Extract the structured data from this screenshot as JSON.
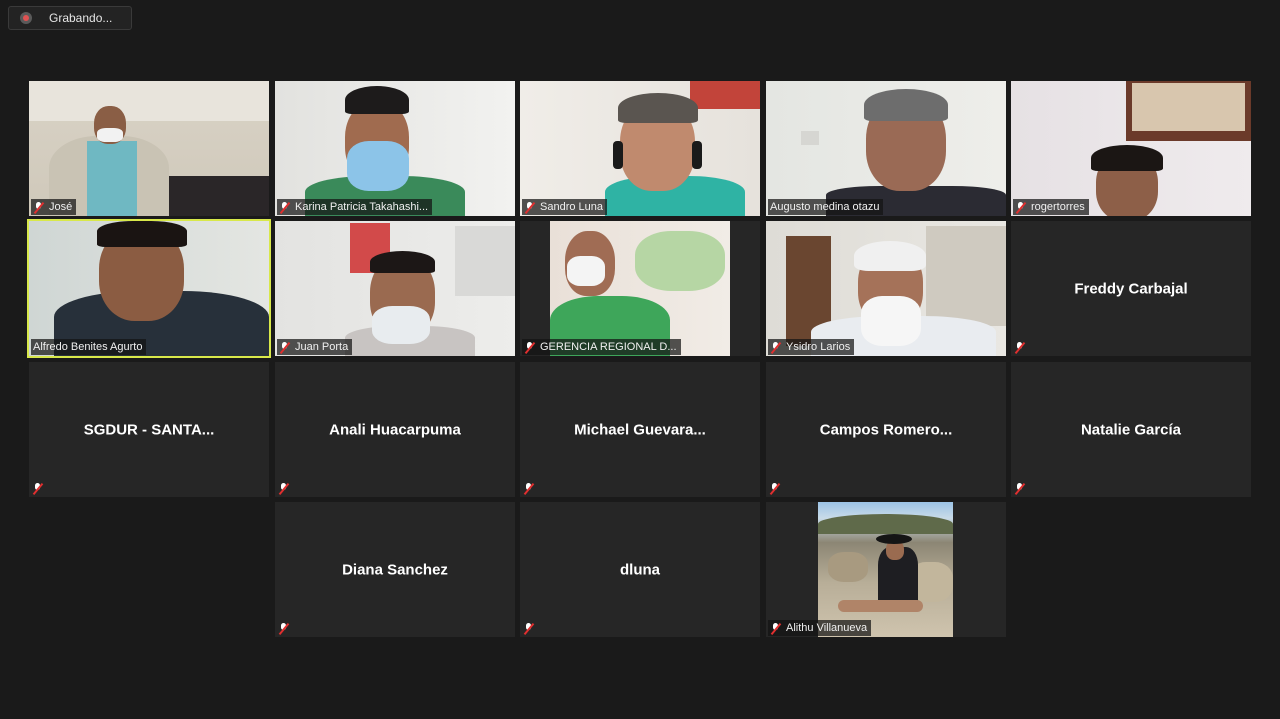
{
  "recording": {
    "label": "Grabando..."
  },
  "participants": [
    {
      "name": "José",
      "muted": true,
      "video": true
    },
    {
      "name": "Karina Patricia Takahashi...",
      "muted": true,
      "video": true
    },
    {
      "name": "Sandro Luna",
      "muted": true,
      "video": true
    },
    {
      "name": "Augusto medina otazu",
      "muted": false,
      "video": true
    },
    {
      "name": "rogertorres",
      "muted": true,
      "video": true
    },
    {
      "name": "Alfredo Benites Agurto",
      "muted": false,
      "video": true,
      "active_speaker": true
    },
    {
      "name": "Juan Porta",
      "muted": true,
      "video": true
    },
    {
      "name": "GERENCIA REGIONAL D...",
      "muted": true,
      "video": true
    },
    {
      "name": "Ysidro Larios",
      "muted": true,
      "video": true
    },
    {
      "name": "Freddy Carbajal",
      "muted": true,
      "video": false
    },
    {
      "name": "SGDUR  -  SANTA...",
      "muted": true,
      "video": false
    },
    {
      "name": "Anali Huacarpuma",
      "muted": true,
      "video": false
    },
    {
      "name": "Michael  Guevara...",
      "muted": true,
      "video": false
    },
    {
      "name": "Campos  Romero...",
      "muted": true,
      "video": false
    },
    {
      "name": "Natalie García",
      "muted": true,
      "video": false
    },
    {
      "name": "Diana Sanchez",
      "muted": true,
      "video": false
    },
    {
      "name": "dluna",
      "muted": true,
      "video": false
    },
    {
      "name": "Alithu Villanueva",
      "muted": true,
      "video": true
    }
  ],
  "colors": {
    "background": "#1a1a1a",
    "tile": "#262626",
    "active_border": "#d8e84a",
    "mute_slash": "#e02f2f"
  }
}
